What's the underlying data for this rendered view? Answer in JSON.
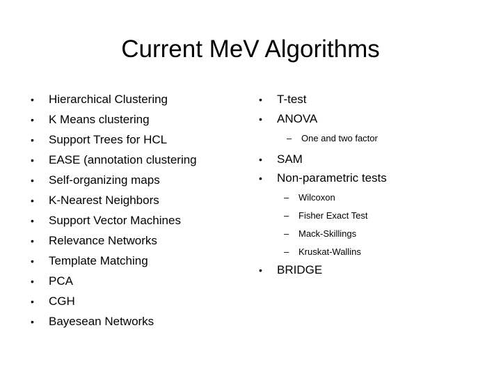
{
  "slide": {
    "title": "Current MeV Algorithms",
    "background_color": "#ffffff",
    "text_color": "#000000",
    "bullet_glyph": "•",
    "dash_glyph": "–"
  },
  "left_column": {
    "items": [
      {
        "label": "Hierarchical Clustering",
        "level": 1
      },
      {
        "label": "K Means clustering",
        "level": 1
      },
      {
        "label": "Support Trees for HCL",
        "level": 1
      },
      {
        "label": "EASE (annotation clustering",
        "level": 1
      },
      {
        "label": "Self-organizing maps",
        "level": 1
      },
      {
        "label": "K-Nearest Neighbors",
        "level": 1
      },
      {
        "label": "Support Vector Machines",
        "level": 1
      },
      {
        "label": "Relevance Networks",
        "level": 1
      },
      {
        "label": "Template Matching",
        "level": 1
      },
      {
        "label": "PCA",
        "level": 1
      },
      {
        "label": "CGH",
        "level": 1
      },
      {
        "label": "Bayesean Networks",
        "level": 1
      }
    ]
  },
  "right_column": {
    "items": [
      {
        "label": "T-test",
        "level": 1
      },
      {
        "label": "ANOVA",
        "level": 1
      },
      {
        "label": "One and two factor",
        "level": 2
      },
      {
        "label": "SAM",
        "level": 1
      },
      {
        "label": "Non-parametric tests",
        "level": 1
      },
      {
        "label": "Wilcoxon",
        "level": 2
      },
      {
        "label": "Fisher Exact Test",
        "level": 2
      },
      {
        "label": "Mack-Skillings",
        "level": 2
      },
      {
        "label": "Kruskat-Wallins",
        "level": 2
      },
      {
        "label": "BRIDGE",
        "level": 1
      }
    ]
  }
}
